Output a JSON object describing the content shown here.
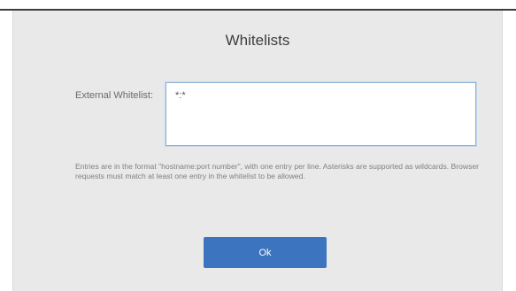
{
  "dialog": {
    "title": "Whitelists",
    "field_label": "External Whitelist:",
    "whitelist_value": "*:*",
    "help_text": "Entries are in the format \"hostname:port number\", with one entry per line. Asterisks are supported as wildcards. Browser requests must match at least one entry in the whitelist to be allowed.",
    "ok_label": "Ok"
  },
  "colors": {
    "dialog_background": "#e9e9e9",
    "button_background": "#3c74bf",
    "input_border": "#8fb2d8"
  }
}
